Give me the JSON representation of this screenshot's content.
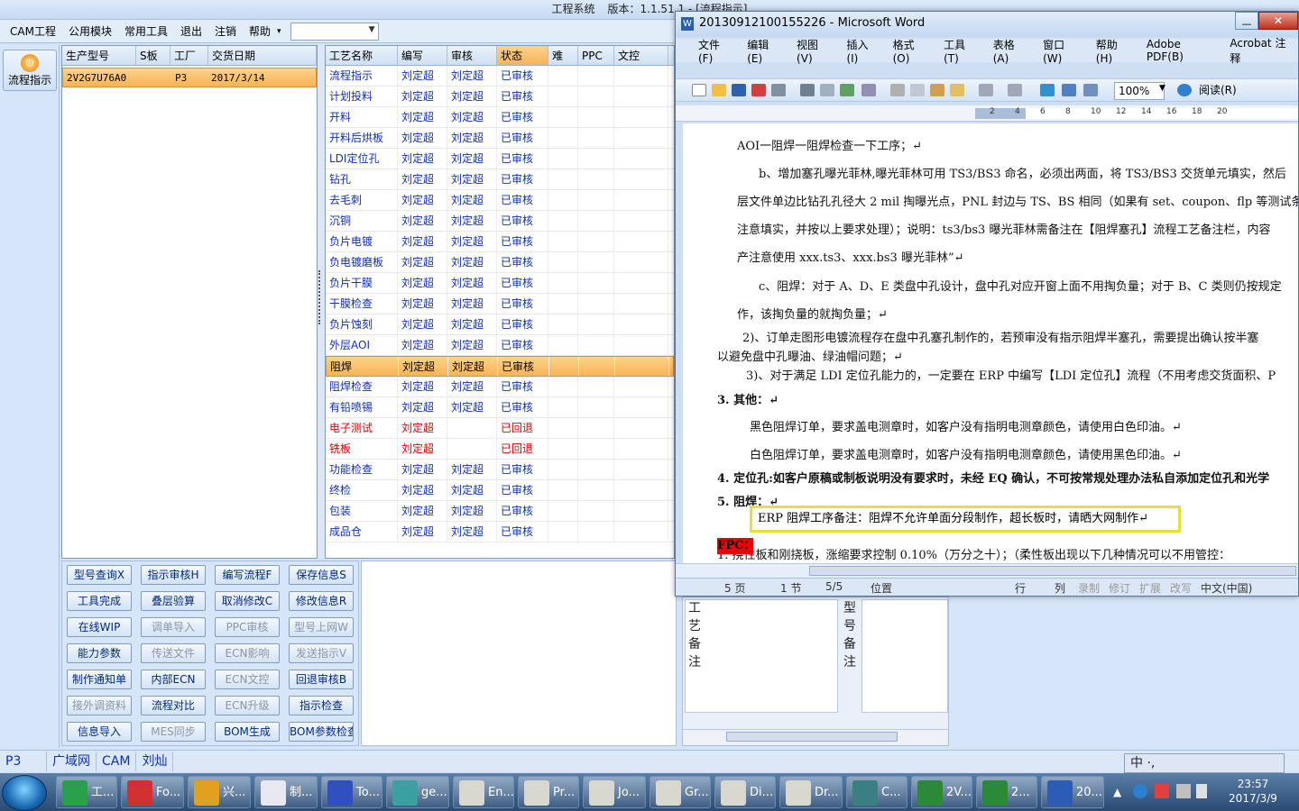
{
  "app": {
    "title": "工程系统",
    "version_label": "版本：1.1.51.1 - [流程指示]"
  },
  "menubar": {
    "items": [
      "CAM工程",
      "公用模块",
      "常用工具",
      "退出",
      "注销",
      "帮助"
    ],
    "help_arrow": "▾"
  },
  "leftbar": {
    "flow_button": "流程指示"
  },
  "order_table": {
    "headers": [
      "生产型号",
      "S板",
      "工厂",
      "交货日期"
    ],
    "row": {
      "model": "2V2G7U76A0",
      "s": "",
      "factory": "P3",
      "date": "2017/3/14"
    }
  },
  "process_table": {
    "headers": [
      "工艺名称",
      "编写",
      "审核",
      "状态",
      "难",
      "PPC",
      "文控"
    ],
    "rows": [
      {
        "name": "流程指示",
        "writer": "刘定超",
        "reviewer": "刘定超",
        "status": "已审核"
      },
      {
        "name": "计划投料",
        "writer": "刘定超",
        "reviewer": "刘定超",
        "status": "已审核"
      },
      {
        "name": "开料",
        "writer": "刘定超",
        "reviewer": "刘定超",
        "status": "已审核"
      },
      {
        "name": "开料后烘板",
        "writer": "刘定超",
        "reviewer": "刘定超",
        "status": "已审核"
      },
      {
        "name": "LDI定位孔",
        "writer": "刘定超",
        "reviewer": "刘定超",
        "status": "已审核"
      },
      {
        "name": "钻孔",
        "writer": "刘定超",
        "reviewer": "刘定超",
        "status": "已审核"
      },
      {
        "name": "去毛刺",
        "writer": "刘定超",
        "reviewer": "刘定超",
        "status": "已审核"
      },
      {
        "name": "沉铜",
        "writer": "刘定超",
        "reviewer": "刘定超",
        "status": "已审核"
      },
      {
        "name": "负片电镀",
        "writer": "刘定超",
        "reviewer": "刘定超",
        "status": "已审核"
      },
      {
        "name": "负电镀磨板",
        "writer": "刘定超",
        "reviewer": "刘定超",
        "status": "已审核"
      },
      {
        "name": "负片干膜",
        "writer": "刘定超",
        "reviewer": "刘定超",
        "status": "已审核"
      },
      {
        "name": "干膜检查",
        "writer": "刘定超",
        "reviewer": "刘定超",
        "status": "已审核"
      },
      {
        "name": "负片蚀刻",
        "writer": "刘定超",
        "reviewer": "刘定超",
        "status": "已审核"
      },
      {
        "name": "外层AOI",
        "writer": "刘定超",
        "reviewer": "刘定超",
        "status": "已审核"
      },
      {
        "name": "阻焊",
        "writer": "刘定超",
        "reviewer": "刘定超",
        "status": "已审核"
      },
      {
        "name": "阻焊检查",
        "writer": "刘定超",
        "reviewer": "刘定超",
        "status": "已审核"
      },
      {
        "name": "有铅喷锡",
        "writer": "刘定超",
        "reviewer": "刘定超",
        "status": "已审核"
      },
      {
        "name": "电子测试",
        "writer": "刘定超",
        "reviewer": "",
        "status": "已回退"
      },
      {
        "name": "铣板",
        "writer": "刘定超",
        "reviewer": "",
        "status": "已回退"
      },
      {
        "name": "功能检查",
        "writer": "刘定超",
        "reviewer": "刘定超",
        "status": "已审核"
      },
      {
        "name": "终检",
        "writer": "刘定超",
        "reviewer": "刘定超",
        "status": "已审核"
      },
      {
        "name": "包装",
        "writer": "刘定超",
        "reviewer": "刘定超",
        "status": "已审核"
      },
      {
        "name": "成品仓",
        "writer": "刘定超",
        "reviewer": "刘定超",
        "status": "已审核"
      }
    ]
  },
  "buttons": [
    {
      "label": "型号查询X",
      "enabled": true
    },
    {
      "label": "指示审核H",
      "enabled": true
    },
    {
      "label": "编写流程F",
      "enabled": true
    },
    {
      "label": "保存信息S",
      "enabled": true
    },
    {
      "label": "工具完成",
      "enabled": true
    },
    {
      "label": "叠层验算",
      "enabled": true
    },
    {
      "label": "取消修改C",
      "enabled": true
    },
    {
      "label": "修改信息R",
      "enabled": true
    },
    {
      "label": "在线WIP",
      "enabled": true
    },
    {
      "label": "调单导入",
      "enabled": false
    },
    {
      "label": "PPC审核",
      "enabled": false
    },
    {
      "label": "型号上网W",
      "enabled": false
    },
    {
      "label": "能力参数",
      "enabled": true
    },
    {
      "label": "传送文件",
      "enabled": false
    },
    {
      "label": "ECN影响",
      "enabled": false
    },
    {
      "label": "发送指示V",
      "enabled": false
    },
    {
      "label": "制作通知单",
      "enabled": true
    },
    {
      "label": "内部ECN",
      "enabled": true
    },
    {
      "label": "ECN文控",
      "enabled": false
    },
    {
      "label": "回退审核B",
      "enabled": true
    },
    {
      "label": "接外调资料",
      "enabled": false
    },
    {
      "label": "流程对比",
      "enabled": true
    },
    {
      "label": "ECN升级",
      "enabled": false
    },
    {
      "label": "指示检查",
      "enabled": true
    },
    {
      "label": "信息导入",
      "enabled": true
    },
    {
      "label": "MES同步",
      "enabled": false
    },
    {
      "label": "BOM生成",
      "enabled": true
    },
    {
      "label": "BOM参数检查",
      "enabled": true
    }
  ],
  "statusbar": {
    "factory": "P3",
    "items": [
      "广域网",
      "CAM",
      "刘灿"
    ]
  },
  "lower_panel": {
    "label1": "工艺备注",
    "label2": "型号备注"
  },
  "word": {
    "title": "20130912100155226 - Microsoft Word",
    "menu": [
      "文件(F)",
      "编辑(E)",
      "视图(V)",
      "插入(I)",
      "格式(O)",
      "工具(T)",
      "表格(A)",
      "窗口(W)",
      "帮助(H)",
      "Adobe PDF(B)",
      "Acrobat 注释"
    ],
    "zoom": "100%",
    "read_label": "阅读(R)",
    "ruler_numbers": [
      "2",
      "4",
      "6",
      "8",
      "10",
      "12",
      "14",
      "16",
      "18",
      "20"
    ],
    "doc_lines": [
      "AOI一阻焊一阻焊检查一下工序；↵",
      "b、增加塞孔曝光菲林,曝光菲林可用 TS3/BS3 命名，必须出两面，将 TS3/BS3 交货单元填实，然后",
      "层文件单边比钻孔孔径大 2 mil 掏曝光点，PNL 封边与 TS、BS 相同（如果有 set、coupon、flp 等测试条",
      "注意填实，并按以上要求处理）；说明：ts3/bs3 曝光菲林需备注在【阻焊塞孔】流程工艺备注栏，内容",
      "产注意使用 xxx.ts3、xxx.bs3 曝光菲林”↵",
      "c、阻焊：对于 A、D、E 类盘中孔设计，盘中孔对应开窗上面不用掏负量；对于 B、C 类则仍按规定",
      "作，该掏负量的就掏负量；↵",
      "2)、订单走图形电镀流程存在盘中孔塞孔制作的，若预审没有指示阻焊半塞孔，需要提出确认按半塞",
      "以避免盘中孔曝油、绿油帽问题；↵",
      "3)、对于满足 LDI 定位孔能力的，一定要在 ERP 中编写【LDI 定位孔】流程（不用考虑交货面积、P",
      "3.  其他：↵",
      "黑色阻焊订单，要求盖电测章时，如客户没有指明电测章颜色，请使用白色印油。↵",
      "白色阻焊订单，要求盖电测章时，如客户没有指明电测章颜色，请使用黑色印油。↵",
      "4.  定位孔:如客户原稿或制板说明没有要求时，未经 EQ 确认，不可按常规处理办法私自添加定位孔和光学",
      "5.  阻焊：↵",
      "1.  挠性板和刚挠板，涨缩要求控制 0.10%（万分之十）；（柔性板出现以下几种情况可以不用管控："
    ],
    "highlight": "ERP 阻焊工序备注：阻焊不允许单面分段制作，超长板时，请晒大网制作↵",
    "fpc": "FPC：",
    "status": {
      "page": "5 页",
      "section": "1 节",
      "pages": "5/5",
      "pos": "位置",
      "line": "行",
      "col": "列",
      "rec": "录制",
      "rev": "修订",
      "ext": "扩展",
      "ovr": "改写",
      "lang": "中文(中国)"
    }
  },
  "ime": {
    "text": "中 ·,"
  },
  "taskbar": {
    "items": [
      "工...",
      "Fo...",
      "兴...",
      "制...",
      "To...",
      "ge...",
      "En...",
      "Pr...",
      "Jo...",
      "Gr...",
      "Di...",
      "Dr...",
      "C...",
      "2V...",
      "2...",
      "20..."
    ],
    "time": "23:57",
    "date": "2017/3/9"
  }
}
